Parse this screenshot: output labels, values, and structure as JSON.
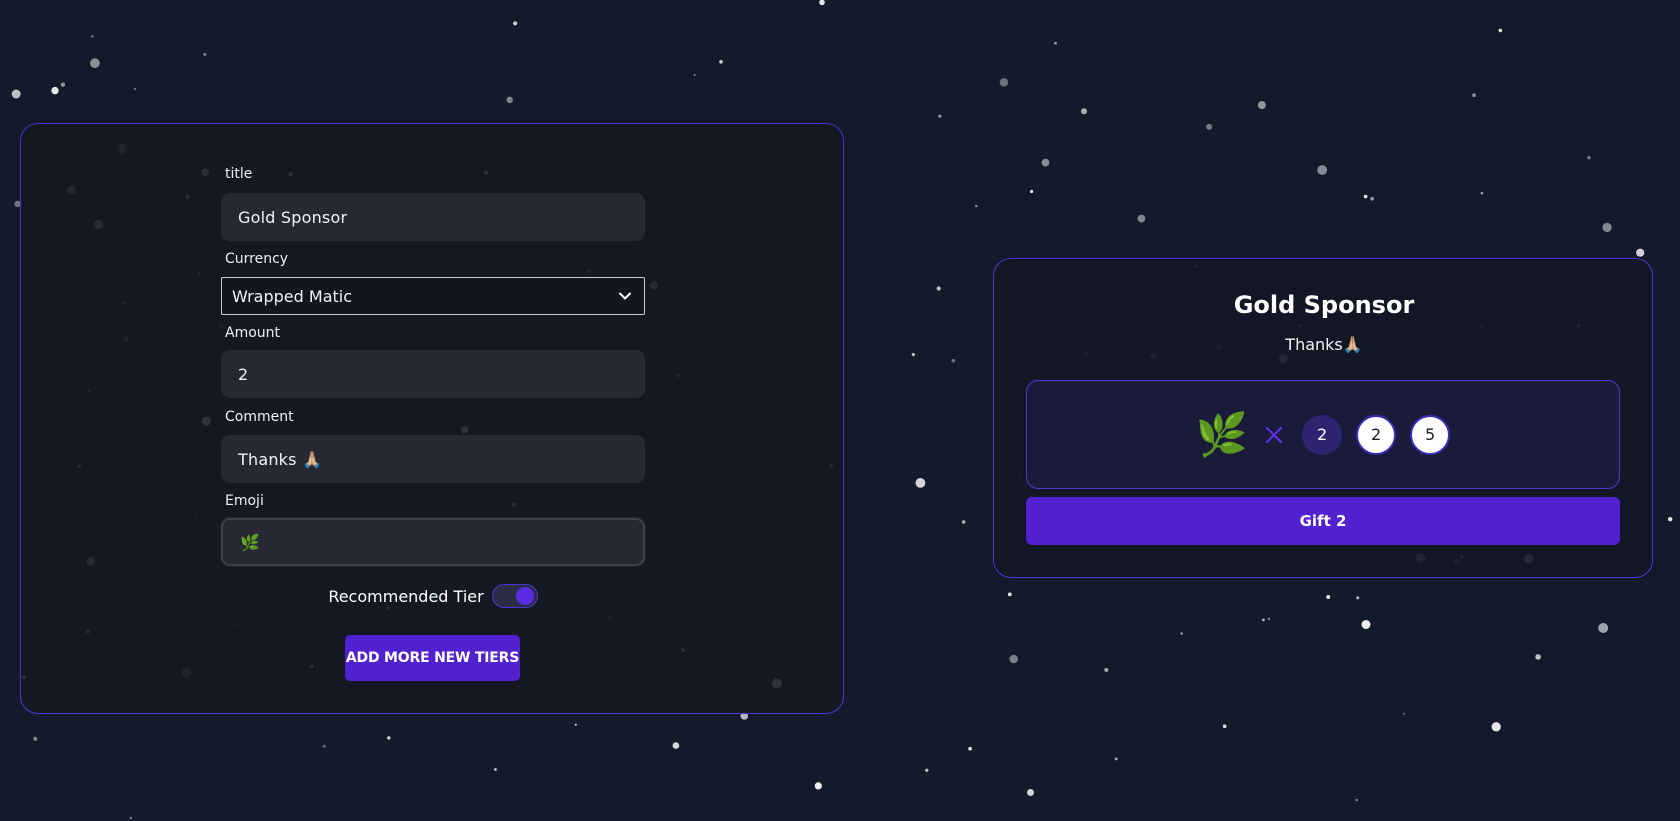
{
  "form": {
    "title_label": "title",
    "title_value": "Gold Sponsor",
    "currency_label": "Currency",
    "currency_value": "Wrapped Matic",
    "amount_label": "Amount",
    "amount_value": "2",
    "comment_label": "Comment",
    "comment_value": "Thanks 🙏🏼",
    "emoji_label": "Emoji",
    "emoji_value": "🌿",
    "toggle_label": "Recommended Tier",
    "recommended_enabled": true,
    "add_button_label": "ADD MORE NEW TIERS"
  },
  "preview": {
    "title": "Gold Sponsor",
    "comment": "Thanks🙏🏼",
    "emoji": "🌿",
    "multiplier_icon": "times-icon",
    "amount_options": [
      "2",
      "2",
      "5"
    ],
    "selected_option_index": 0,
    "gift_button_label": "Gift 2"
  },
  "theme": {
    "background": "#121a2c",
    "accent": "#5121d0",
    "border": "#4c35d6"
  }
}
